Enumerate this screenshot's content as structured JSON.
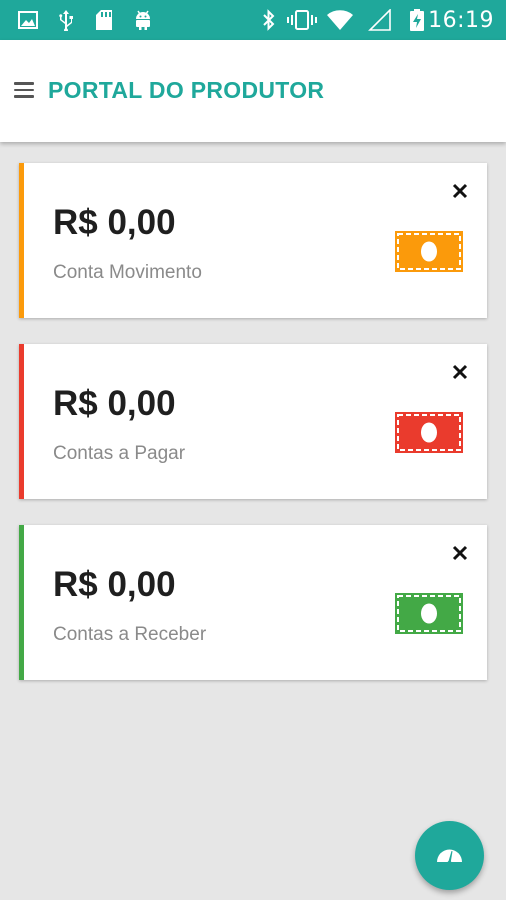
{
  "status_bar": {
    "time": "16:19",
    "icons": [
      "image-icon",
      "usb-icon",
      "sd-card-icon",
      "android-icon",
      "bluetooth-icon",
      "vibrate-icon",
      "wifi-icon",
      "signal-icon",
      "battery-charging-icon"
    ]
  },
  "app_bar": {
    "title": "PORTAL DO PRODUTOR",
    "menu_icon": "menu-icon"
  },
  "cards": [
    {
      "amount": "R$ 0,00",
      "label": "Conta Movimento",
      "accent": "#fb9a0b",
      "icon": "money-icon"
    },
    {
      "amount": "R$ 0,00",
      "label": "Contas a Pagar",
      "accent": "#ea3b2d",
      "icon": "money-icon"
    },
    {
      "amount": "R$ 0,00",
      "label": "Contas a Receber",
      "accent": "#43a946",
      "icon": "money-icon"
    }
  ],
  "fab": {
    "icon": "speedometer-icon",
    "color": "#1fa89b"
  },
  "colors": {
    "primary": "#1fa89b",
    "background": "#e6e6e6"
  }
}
